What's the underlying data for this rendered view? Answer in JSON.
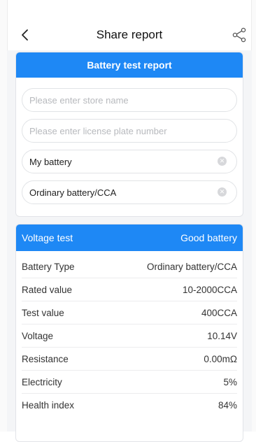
{
  "navbar": {
    "title": "Share report",
    "back_icon": "chevron-left",
    "share_icon": "share"
  },
  "report_card": {
    "header": "Battery test report",
    "fields": [
      {
        "placeholder": "Please enter store name",
        "value": ""
      },
      {
        "placeholder": "Please enter license plate number",
        "value": ""
      },
      {
        "placeholder": "",
        "value": "My battery"
      },
      {
        "placeholder": "",
        "value": "Ordinary battery/CCA"
      }
    ]
  },
  "result_card": {
    "test_label": "Voltage test",
    "result": "Good battery",
    "rows": [
      {
        "label": "Battery Type",
        "value": "Ordinary battery/CCA"
      },
      {
        "label": "Rated value",
        "value": "10-2000CCA"
      },
      {
        "label": "Test value",
        "value": "400CCA"
      },
      {
        "label": "Voltage",
        "value": "10.14V"
      },
      {
        "label": "Resistance",
        "value": "0.00mΩ"
      },
      {
        "label": "Electricity",
        "value": "5%"
      },
      {
        "label": "Health index",
        "value": "84%"
      }
    ]
  },
  "colors": {
    "accent": "#1e88f5",
    "page_bg": "#f4f5f7"
  }
}
